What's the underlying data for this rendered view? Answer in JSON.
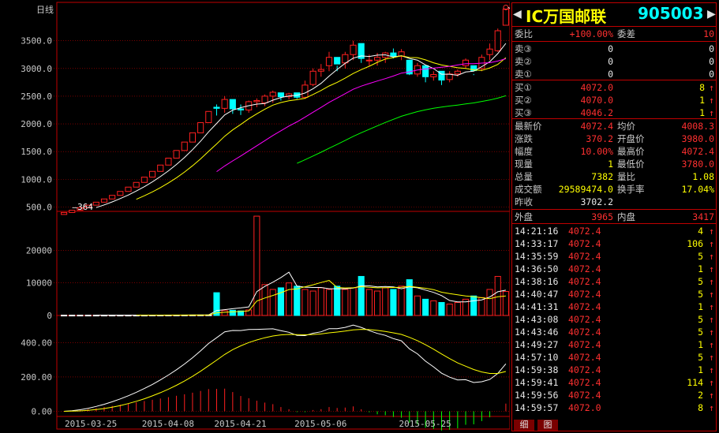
{
  "chart_data": {
    "type": "candlestick",
    "period_label": "日线",
    "x_tick_labels": [
      "2015-03-25",
      "2015-04-08",
      "2015-04-21",
      "2015-05-06",
      "2015-05-25"
    ],
    "price_panel": {
      "y_ticks": [
        "500.0",
        "1000.0",
        "1500.0",
        "2000.0",
        "2500.0",
        "3000.0",
        "3500.0"
      ],
      "ylim": [
        420,
        4150
      ],
      "low_marker": "364",
      "high_marker": "4072.4",
      "candles": [
        [
          364,
          400,
          364,
          400
        ],
        [
          400,
          440,
          400,
          440
        ],
        [
          440,
          484,
          440,
          484
        ],
        [
          484,
          532,
          484,
          532
        ],
        [
          532,
          586,
          532,
          586
        ],
        [
          586,
          644,
          586,
          644
        ],
        [
          644,
          709,
          644,
          709
        ],
        [
          709,
          780,
          709,
          780
        ],
        [
          780,
          858,
          780,
          858
        ],
        [
          858,
          943,
          858,
          943
        ],
        [
          943,
          1038,
          943,
          1038
        ],
        [
          1038,
          1142,
          1038,
          1142
        ],
        [
          1142,
          1256,
          1142,
          1256
        ],
        [
          1256,
          1381,
          1256,
          1381
        ],
        [
          1381,
          1519,
          1381,
          1519
        ],
        [
          1519,
          1671,
          1519,
          1671
        ],
        [
          1671,
          1838,
          1671,
          1838
        ],
        [
          1838,
          2022,
          1838,
          2022
        ],
        [
          2022,
          2224,
          2022,
          2224
        ],
        [
          2300,
          2350,
          2150,
          2280
        ],
        [
          2280,
          2500,
          2200,
          2440
        ],
        [
          2440,
          2300,
          2180,
          2270
        ],
        [
          2270,
          2350,
          2160,
          2250
        ],
        [
          2250,
          2420,
          2200,
          2400
        ],
        [
          2400,
          2460,
          2300,
          2420
        ],
        [
          2380,
          2530,
          2320,
          2500
        ],
        [
          2500,
          2600,
          2380,
          2570
        ],
        [
          2560,
          2500,
          2420,
          2490
        ],
        [
          2490,
          2560,
          2440,
          2540
        ],
        [
          2560,
          2500,
          2450,
          2480
        ],
        [
          2480,
          2780,
          2450,
          2700
        ],
        [
          2710,
          3000,
          2680,
          2950
        ],
        [
          2950,
          3080,
          2850,
          2980
        ],
        [
          3050,
          3300,
          2950,
          3200
        ],
        [
          3200,
          3050,
          2950,
          3080
        ],
        [
          3100,
          3300,
          3000,
          3250
        ],
        [
          3250,
          3500,
          3150,
          3420
        ],
        [
          3450,
          3180,
          3100,
          3180
        ],
        [
          3150,
          3250,
          3050,
          3150
        ],
        [
          3150,
          3280,
          3050,
          3200
        ],
        [
          3200,
          3300,
          3100,
          3280
        ],
        [
          3280,
          3360,
          3180,
          3220
        ],
        [
          3220,
          3350,
          3150,
          3300
        ],
        [
          3150,
          2920,
          2880,
          2900
        ],
        [
          2900,
          3100,
          2850,
          3050
        ],
        [
          3050,
          2900,
          2750,
          2850
        ],
        [
          2850,
          2950,
          2780,
          2890
        ],
        [
          2950,
          2800,
          2700,
          2790
        ],
        [
          2800,
          2950,
          2750,
          2900
        ],
        [
          2900,
          2980,
          2850,
          2950
        ],
        [
          3050,
          3180,
          3000,
          3150
        ],
        [
          3050,
          2900,
          2880,
          2960
        ],
        [
          3000,
          3250,
          2950,
          3200
        ],
        [
          3250,
          3450,
          3150,
          3350
        ],
        [
          3320,
          3720,
          3300,
          3680
        ],
        [
          3780,
          4072.4,
          3780,
          4072.4
        ]
      ]
    },
    "volume_panel": {
      "y_ticks": [
        "0",
        "10000",
        "20000"
      ],
      "ylim": [
        0,
        31000
      ],
      "values": [
        100,
        100,
        100,
        100,
        100,
        100,
        100,
        100,
        100,
        100,
        100,
        120,
        120,
        130,
        140,
        150,
        160,
        170,
        180,
        7000,
        1500,
        1600,
        1400,
        1700,
        30500,
        9500,
        8000,
        8500,
        10000,
        9000,
        8000,
        7500,
        8500,
        8000,
        9000,
        8000,
        8500,
        12000,
        8000,
        7500,
        8500,
        8000,
        9000,
        11000,
        6000,
        5000,
        4500,
        4000,
        3500,
        4000,
        5000,
        6000,
        5500,
        8000,
        12000,
        7382
      ]
    },
    "macd_panel": {
      "y_ticks": [
        "0.00",
        "200.00",
        "400.00"
      ],
      "ylim": [
        -30,
        540
      ]
    },
    "moving_averages": [
      "MA5",
      "MA10",
      "MA20",
      "MA60"
    ],
    "colors": {
      "up": "#ff2020",
      "down": "#00ffff",
      "ma5": "#ffffff",
      "ma10": "#ffff00",
      "ma20": "#ff00ff",
      "ma60": "#00ff00",
      "frame": "#c00000",
      "dif": "#ffffff",
      "dea": "#ffff00"
    }
  },
  "panel": {
    "title": "IC万国邮联",
    "code": "905003",
    "wei_bi_label": "委比",
    "wei_bi": "+100.00%",
    "wei_cha_label": "委差",
    "wei_cha": "10",
    "sells": [
      {
        "label": "卖③",
        "price": "0",
        "vol": "0"
      },
      {
        "label": "卖②",
        "price": "0",
        "vol": "0"
      },
      {
        "label": "卖①",
        "price": "0",
        "vol": "0"
      }
    ],
    "buys": [
      {
        "label": "买①",
        "price": "4072.0",
        "vol": "8"
      },
      {
        "label": "买②",
        "price": "4070.0",
        "vol": "1"
      },
      {
        "label": "买③",
        "price": "4046.2",
        "vol": "1"
      }
    ],
    "stats": {
      "last_label": "最新价",
      "last": "4072.4",
      "avg_label": "均价",
      "avg": "4008.3",
      "chg_label": "涨跌",
      "chg": "370.2",
      "open_label": "开盘价",
      "open": "3980.0",
      "pct_label": "幅度",
      "pct": "10.00%",
      "high_label": "最高价",
      "high": "4072.4",
      "cur_label": "现量",
      "cur": "1",
      "low_label": "最低价",
      "low": "3780.0",
      "total_label": "总量",
      "total": "7382",
      "ratio_label": "量比",
      "ratio": "1.08",
      "amount_label": "成交额",
      "amount": "29589474.0",
      "turnover_label": "换手率",
      "turnover": "17.04%",
      "prev_label": "昨收",
      "prev": "3702.2"
    },
    "outer_label": "外盘",
    "outer": "3965",
    "inner_label": "内盘",
    "inner": "3417",
    "ticks": [
      {
        "time": "14:21:16",
        "price": "4072.4",
        "vol": "4"
      },
      {
        "time": "14:33:17",
        "price": "4072.4",
        "vol": "106"
      },
      {
        "time": "14:35:59",
        "price": "4072.4",
        "vol": "5"
      },
      {
        "time": "14:36:50",
        "price": "4072.4",
        "vol": "1"
      },
      {
        "time": "14:38:16",
        "price": "4072.4",
        "vol": "5"
      },
      {
        "time": "14:40:47",
        "price": "4072.4",
        "vol": "5"
      },
      {
        "time": "14:41:31",
        "price": "4072.4",
        "vol": "1"
      },
      {
        "time": "14:43:08",
        "price": "4072.4",
        "vol": "5"
      },
      {
        "time": "14:43:46",
        "price": "4072.4",
        "vol": "5"
      },
      {
        "time": "14:49:27",
        "price": "4072.4",
        "vol": "1"
      },
      {
        "time": "14:57:10",
        "price": "4072.4",
        "vol": "5"
      },
      {
        "time": "14:59:38",
        "price": "4072.4",
        "vol": "1"
      },
      {
        "time": "14:59:41",
        "price": "4072.4",
        "vol": "114"
      },
      {
        "time": "14:59:56",
        "price": "4072.4",
        "vol": "2"
      },
      {
        "time": "14:59:57",
        "price": "4072.0",
        "vol": "8"
      }
    ],
    "tabs": [
      "细",
      "图"
    ]
  }
}
